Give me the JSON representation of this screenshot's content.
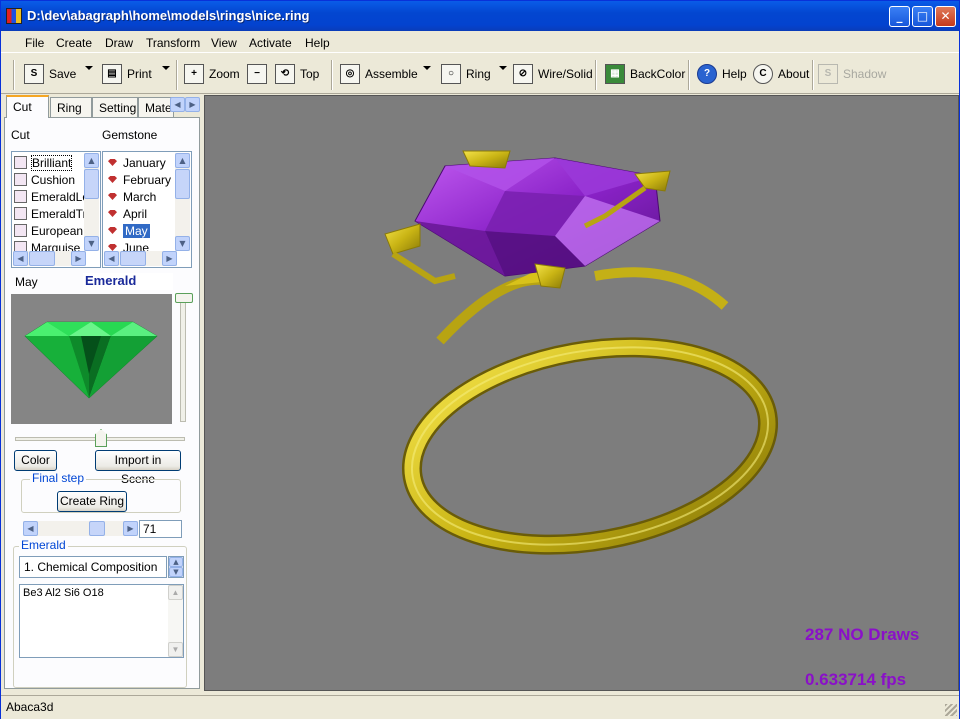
{
  "window": {
    "title": "D:\\dev\\abagraph\\home\\models\\rings\\nice.ring",
    "minimize": "_",
    "maximize": "□",
    "close": "✕"
  },
  "menu": [
    "File",
    "Create",
    "Draw",
    "Transform",
    "View",
    "Activate",
    "Help"
  ],
  "toolbar": {
    "save": "Save",
    "print": "Print",
    "zoom": "Zoom",
    "top": "Top",
    "assemble": "Assemble",
    "ring": "Ring",
    "wire_solid": "Wire/Solid",
    "back_color": "BackColor",
    "help": "Help",
    "about": "About",
    "shadow": "Shadow"
  },
  "tabs": [
    "Cut",
    "Ring",
    "Setting",
    "Mate"
  ],
  "cut_panel": {
    "cut_label": "Cut",
    "gemstone_label": "Gemstone",
    "cuts": [
      "Brilliant",
      "Cushion",
      "EmeraldLor",
      "EmeraldTra",
      "European",
      "Marquise"
    ],
    "gemstones": [
      "January",
      "February",
      "March",
      "April",
      "May",
      "June"
    ],
    "selected_gem_index": 4,
    "selected_month": "May",
    "selected_stone": "Emerald",
    "color_button": "Color",
    "import_button": "Import in Scene",
    "final_step_title": "Final step",
    "create_ring_button": "Create Ring",
    "slider_value": "71",
    "info_group_title": "Emerald",
    "info_select": "1. Chemical Composition",
    "info_text": "Be3 Al2 Si6 O18",
    "colors": {
      "preview_gem": "#1fd14a",
      "viewport_gem": "#9a2ad6",
      "gold": "#d8c21a"
    }
  },
  "viewport": {
    "draws": "287 NO Draws",
    "fps": "0.633714 fps",
    "background": "#7d7d7d"
  },
  "status": {
    "text": "Abaca3d"
  }
}
